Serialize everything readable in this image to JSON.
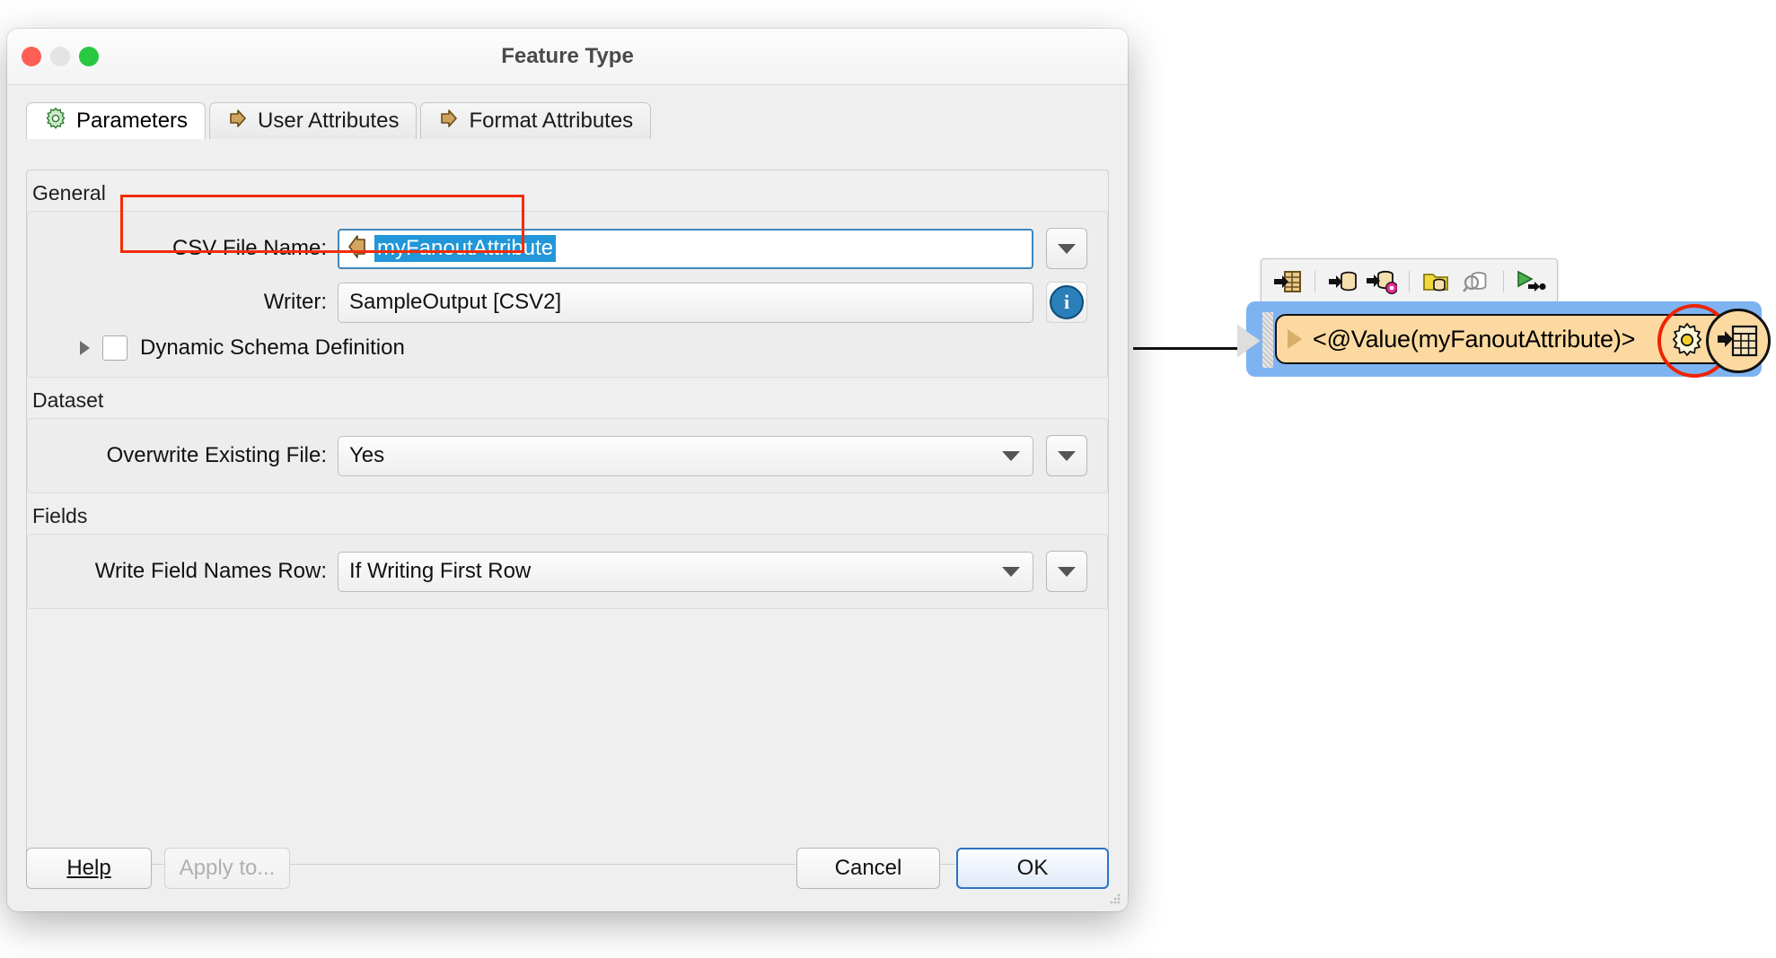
{
  "window": {
    "title": "Feature Type",
    "traffic_lights": [
      "close-button",
      "minimize-button",
      "maximize-button"
    ]
  },
  "tabs": [
    {
      "label": "Parameters",
      "icon": "gear-icon",
      "active": true
    },
    {
      "label": "User Attributes",
      "icon": "arrow-right-icon",
      "active": false
    },
    {
      "label": "Format Attributes",
      "icon": "arrow-right-icon",
      "active": false
    }
  ],
  "sections": {
    "general": {
      "title": "General",
      "csv_file_name": {
        "label": "CSV File Name:",
        "value": "myFanoutAttribute",
        "selected": true,
        "icon": "attribute-arrow-icon",
        "dropdown_icon": "chevron-down-icon",
        "highlighted": true,
        "highlight_color": "#f22b0a"
      },
      "writer": {
        "label": "Writer:",
        "value": "SampleOutput [CSV2]",
        "info_icon": "info-icon",
        "info_label": "i"
      },
      "dynamic_schema": {
        "label": "Dynamic Schema Definition",
        "checked": false,
        "expander_icon": "triangle-right-icon"
      }
    },
    "dataset": {
      "title": "Dataset",
      "overwrite": {
        "label": "Overwrite Existing File:",
        "value": "Yes",
        "dropdown_icon": "chevron-down-icon"
      }
    },
    "fields": {
      "title": "Fields",
      "write_field_names": {
        "label": "Write Field Names Row:",
        "value": "If Writing First Row",
        "dropdown_icon": "chevron-down-icon"
      }
    }
  },
  "buttons": {
    "help": "Help",
    "apply_to": "Apply to...",
    "cancel": "Cancel",
    "ok": "OK"
  },
  "workspace": {
    "node": {
      "label": "<@Value(myFanoutAttribute)>",
      "selected": true,
      "selection_color": "#7eb3f2",
      "body_color": "#fbd9a0",
      "gear_icon": "gear-icon",
      "gear_highlight_color": "#ee2200",
      "badge_icon": "table-writer-icon",
      "input_port_icon": "input-port-arrow-icon"
    },
    "toolbar": [
      {
        "icon": "add-feature-type-icon"
      },
      {
        "icon": "add-reader-icon"
      },
      {
        "icon": "add-transformer-icon"
      },
      {
        "icon": "add-folder-dataset-icon"
      },
      {
        "icon": "inspect-dataset-icon"
      },
      {
        "icon": "run-to-this-icon"
      }
    ]
  }
}
